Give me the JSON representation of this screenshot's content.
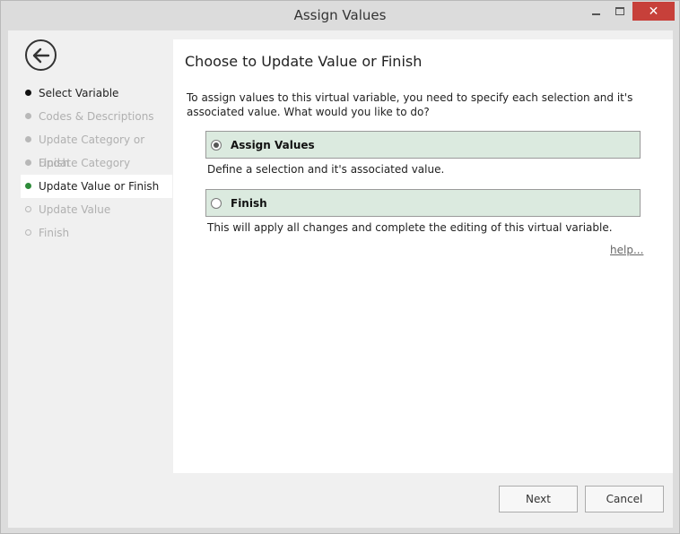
{
  "window": {
    "title": "Assign Values",
    "close_glyph": "✕"
  },
  "sidebar": {
    "back_icon": "back-arrow-icon",
    "steps": [
      {
        "label": "Select Variable",
        "state": "done"
      },
      {
        "label": "Codes & Descriptions",
        "state": "disabled"
      },
      {
        "label": "Update Category or Finish",
        "state": "disabled"
      },
      {
        "label": "Update Category",
        "state": "disabled"
      },
      {
        "label": "Update Value or Finish",
        "state": "active"
      },
      {
        "label": "Update Value",
        "state": "pending"
      },
      {
        "label": "Finish",
        "state": "pending"
      }
    ]
  },
  "main": {
    "heading": "Choose to Update Value or Finish",
    "intro": "To assign values to this virtual variable, you need to specify each selection and it's associated value. What would you like to do?",
    "options": [
      {
        "label": "Assign Values",
        "checked": true,
        "description": "Define a selection and it's associated value."
      },
      {
        "label": "Finish",
        "checked": false,
        "description": "This will apply all changes and complete the editing of this virtual variable."
      }
    ],
    "help_link": "help..."
  },
  "footer": {
    "next_label": "Next",
    "cancel_label": "Cancel"
  },
  "colors": {
    "option_bg": "#dbeadf",
    "close_bg": "#c7403a",
    "active_dot": "#2e8b3a"
  }
}
